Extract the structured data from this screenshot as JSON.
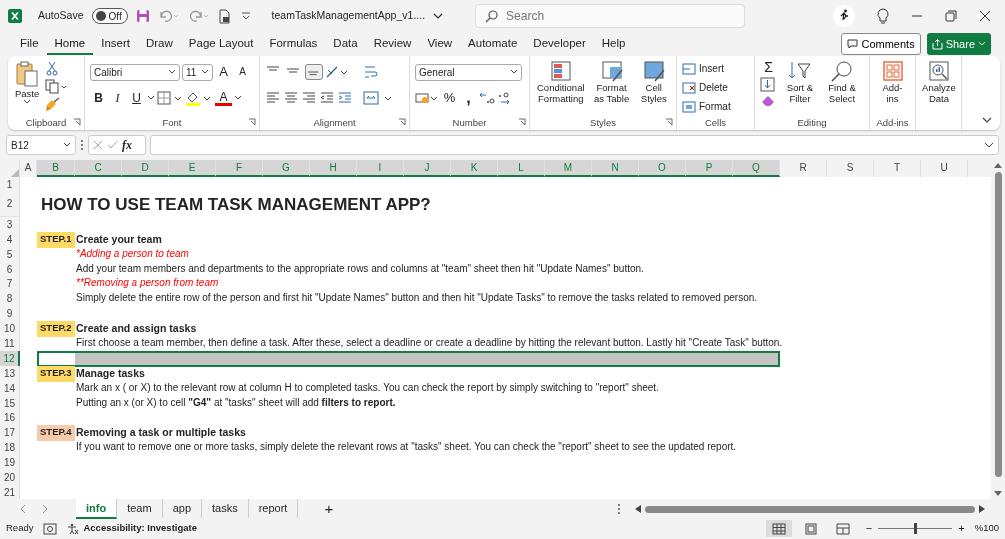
{
  "titlebar": {
    "autosave": "AutoSave",
    "autosave_toggle": {
      "label": "Off",
      "on": false
    },
    "filename": "teamTaskManagementApp_v1....",
    "search": {
      "placeholder": "Search"
    }
  },
  "menu": {
    "tabs": [
      {
        "label": "File",
        "selected": false
      },
      {
        "label": "Home",
        "selected": true
      },
      {
        "label": "Insert",
        "selected": false
      },
      {
        "label": "Draw",
        "selected": false
      },
      {
        "label": "Page Layout",
        "selected": false
      },
      {
        "label": "Formulas",
        "selected": false
      },
      {
        "label": "Data",
        "selected": false
      },
      {
        "label": "Review",
        "selected": false
      },
      {
        "label": "View",
        "selected": false
      },
      {
        "label": "Automate",
        "selected": false
      },
      {
        "label": "Developer",
        "selected": false
      },
      {
        "label": "Help",
        "selected": false
      }
    ],
    "comments": "Comments",
    "share": "Share"
  },
  "ribbon": {
    "clipboard": {
      "paste": "Paste",
      "label": "Clipboard"
    },
    "font": {
      "name": "Calibri",
      "size": "11",
      "grow": "A",
      "shrink": "A",
      "bold": "B",
      "italic": "I",
      "underline": "U",
      "font_color_glyph": "A",
      "label": "Font"
    },
    "alignment": {
      "vertical": [
        {
          "selected": false
        },
        {
          "selected": false
        },
        {
          "selected": true
        }
      ],
      "label": "Alignment"
    },
    "number": {
      "format": "General",
      "percent": "%",
      "comma": ",",
      "label": "Number"
    },
    "styles": {
      "conditional": "Conditional Formatting",
      "table": "Format as Table",
      "cell": "Cell Styles",
      "label": "Styles"
    },
    "cells": {
      "insert": "Insert",
      "delete": "Delete",
      "format": "Format",
      "label": "Cells"
    },
    "editing": {
      "sum": "Σ",
      "sort": "Sort & Filter",
      "find": "Find & Select",
      "label": "Editing"
    },
    "addins": {
      "addins": "Add-ins",
      "label": "Add-ins"
    },
    "analyze": "Analyze Data"
  },
  "formula_bar": {
    "name_box": "B12",
    "fx": "fx"
  },
  "columns": [
    {
      "label": "A",
      "selected": false
    },
    {
      "label": "B",
      "selected": true
    },
    {
      "label": "C",
      "selected": true
    },
    {
      "label": "D",
      "selected": true
    },
    {
      "label": "E",
      "selected": true
    },
    {
      "label": "F",
      "selected": true
    },
    {
      "label": "G",
      "selected": true
    },
    {
      "label": "H",
      "selected": true
    },
    {
      "label": "I",
      "selected": true
    },
    {
      "label": "J",
      "selected": true
    },
    {
      "label": "K",
      "selected": true
    },
    {
      "label": "L",
      "selected": true
    },
    {
      "label": "M",
      "selected": true
    },
    {
      "label": "N",
      "selected": true
    },
    {
      "label": "O",
      "selected": true
    },
    {
      "label": "P",
      "selected": true
    },
    {
      "label": "Q",
      "selected": true
    },
    {
      "label": "R",
      "selected": false
    },
    {
      "label": "S",
      "selected": false
    },
    {
      "label": "T",
      "selected": false
    },
    {
      "label": "U",
      "selected": false
    }
  ],
  "rows": [
    {
      "number": "1",
      "selected": false,
      "cells": []
    },
    {
      "number": "2",
      "selected": false,
      "cells": [
        {
          "kind": "title",
          "text": "HOW TO USE TEAM TASK MANAGEMENT APP?"
        }
      ]
    },
    {
      "number": "3",
      "selected": false,
      "cells": []
    },
    {
      "number": "4",
      "selected": false,
      "cells": [
        {
          "kind": "step",
          "text": "STEP.1",
          "color": "#ffd966"
        },
        {
          "kind": "heading",
          "text": "Create your team"
        }
      ]
    },
    {
      "number": "5",
      "selected": false,
      "cells": [
        {
          "kind": "note",
          "text": "*Adding a person to team"
        }
      ]
    },
    {
      "number": "6",
      "selected": false,
      "cells": [
        {
          "kind": "text",
          "text": "Add your team members and departments to the appropriate rows and columns at \"team\" sheet then hit \"Update Names\" button."
        }
      ]
    },
    {
      "number": "7",
      "selected": false,
      "cells": [
        {
          "kind": "note",
          "text": "**Removing a person from team"
        }
      ]
    },
    {
      "number": "8",
      "selected": false,
      "cells": [
        {
          "kind": "text",
          "text": "Simply delete the entire row of the person and first hit \"Update Names\" button and then hit \"Update Tasks\" to remove the tasks related to removed person."
        }
      ]
    },
    {
      "number": "9",
      "selected": false,
      "cells": []
    },
    {
      "number": "10",
      "selected": false,
      "cells": [
        {
          "kind": "step",
          "text": "STEP.2",
          "color": "#ffd966"
        },
        {
          "kind": "heading",
          "text": "Create and assign tasks"
        }
      ]
    },
    {
      "number": "11",
      "selected": false,
      "cells": [
        {
          "kind": "text",
          "text": "First choose a team member, then define a task. After these, select a deadline or create a deadline by hitting the relevant button. Lastly hit \"Create Task\" button."
        }
      ]
    },
    {
      "number": "12",
      "selected": true,
      "cells": []
    },
    {
      "number": "13",
      "selected": false,
      "cells": [
        {
          "kind": "step",
          "text": "STEP.3",
          "color": "#ffd966"
        },
        {
          "kind": "heading",
          "text": "Manage tasks"
        }
      ]
    },
    {
      "number": "14",
      "selected": false,
      "cells": [
        {
          "kind": "text",
          "text": "Mark an x ( or X) to the relevant row at column H to completed tasks. You can check the report by simply switching to \"report\" sheet."
        }
      ]
    },
    {
      "number": "15",
      "selected": false,
      "cells": [
        {
          "kind": "text",
          "text": "Putting an x (or X) to cell **\"G4\"** at \"tasks\" sheet will add **filters to report.**"
        }
      ]
    },
    {
      "number": "16",
      "selected": false,
      "cells": []
    },
    {
      "number": "17",
      "selected": false,
      "cells": [
        {
          "kind": "step",
          "text": "STEP.4",
          "color": "#f8cbad"
        },
        {
          "kind": "heading",
          "text": "Removing a task or multiple tasks"
        }
      ]
    },
    {
      "number": "18",
      "selected": false,
      "cells": [
        {
          "kind": "text",
          "text": "If you want to remove one or more tasks, simply delete the relevant rows at \"tasks\" sheet. You can check the \"report\" sheet to see the updated report."
        }
      ]
    },
    {
      "number": "19",
      "selected": false,
      "cells": []
    },
    {
      "number": "20",
      "selected": false,
      "cells": []
    },
    {
      "number": "21",
      "selected": false,
      "cells": []
    }
  ],
  "sheet_tabs": {
    "tabs": [
      {
        "label": "info",
        "selected": true
      },
      {
        "label": "team",
        "selected": false
      },
      {
        "label": "app",
        "selected": false
      },
      {
        "label": "tasks",
        "selected": false
      },
      {
        "label": "report",
        "selected": false
      }
    ],
    "add": "+"
  },
  "status_bar": {
    "ready": "Ready",
    "accessibility": "Accessibility: Investigate",
    "views": [
      {
        "kind": "normal",
        "selected": true
      },
      {
        "kind": "page_layout",
        "selected": false
      },
      {
        "kind": "page_break",
        "selected": false
      }
    ],
    "zoom_out": "−",
    "zoom": {
      "level": 0.5
    },
    "zoom_in": "+",
    "zoom_label": "%100"
  }
}
